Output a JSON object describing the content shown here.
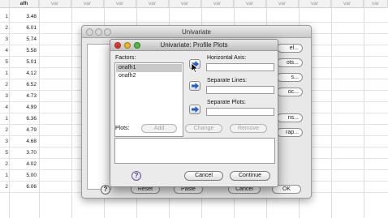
{
  "spreadsheet": {
    "first_column_header": "afh",
    "column_headers": [
      "var",
      "var",
      "var",
      "var",
      "var",
      "var",
      "var",
      "var",
      "var",
      "var",
      "var"
    ],
    "rows": [
      {
        "num": "1",
        "value": "3.48"
      },
      {
        "num": "2",
        "value": "6.01"
      },
      {
        "num": "3",
        "value": "5.74"
      },
      {
        "num": "4",
        "value": "5.58"
      },
      {
        "num": "5",
        "value": "5.01"
      },
      {
        "num": "1",
        "value": "4.12"
      },
      {
        "num": "2",
        "value": "6.52"
      },
      {
        "num": "3",
        "value": "4.73"
      },
      {
        "num": "4",
        "value": "4.99"
      },
      {
        "num": "1",
        "value": "6.36"
      },
      {
        "num": "2",
        "value": "4.79"
      },
      {
        "num": "3",
        "value": "4.68"
      },
      {
        "num": "5",
        "value": "3.70"
      },
      {
        "num": "2",
        "value": "4.02"
      },
      {
        "num": "1",
        "value": "5.00"
      },
      {
        "num": "2",
        "value": "6.06"
      }
    ]
  },
  "univariate_window": {
    "title": "Univariate",
    "side_buttons": [
      "el...",
      "ots...",
      "s...",
      "oc...",
      "ns...",
      "rap..."
    ],
    "bottom_buttons": {
      "reset": "Reset",
      "paste": "Paste",
      "cancel": "Cancel",
      "ok": "OK"
    },
    "help": "?"
  },
  "profile_plots": {
    "title": "Univariate: Profile Plots",
    "factors_label": "Factors:",
    "factors": [
      "onafh1",
      "onafh2"
    ],
    "selected_factor": "onafh1",
    "horizontal_axis_label": "Horizontal Axis:",
    "separate_lines_label": "Separate Lines:",
    "separate_plots_label": "Separate Plots:",
    "plots_label": "Plots:",
    "add_label": "Add",
    "change_label": "Change",
    "remove_label": "Remove",
    "help_label": "?",
    "cancel_label": "Cancel",
    "continue_label": "Continue"
  },
  "icons": {
    "arrow": "right-arrow-icon",
    "help": "question-icon"
  },
  "colors": {
    "close_light": "#e0443e",
    "minimize_light": "#e7b62f",
    "zoom_light": "#53b84a",
    "selection": "#c9c9c9",
    "arrow_blue": "#1f5fd1"
  }
}
